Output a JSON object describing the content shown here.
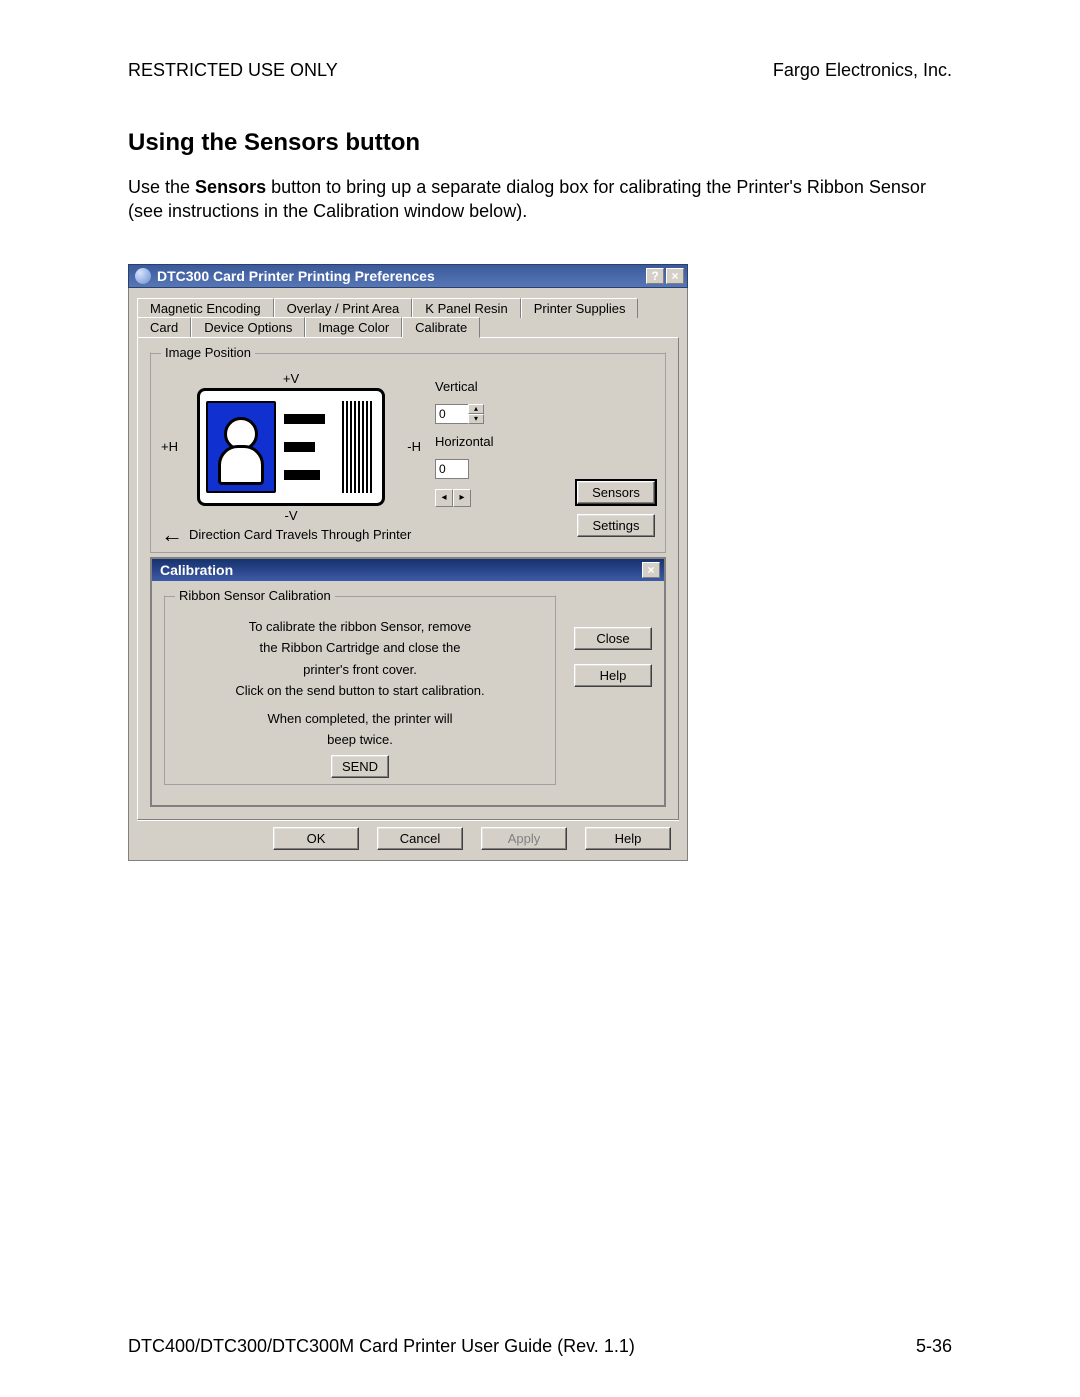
{
  "header": {
    "left": "RESTRICTED USE ONLY",
    "right": "Fargo Electronics, Inc."
  },
  "section_title": "Using the Sensors button",
  "body_pre": "Use the ",
  "body_bold": "Sensors",
  "body_post": " button to bring up a separate dialog box for calibrating the Printer's Ribbon Sensor (see instructions in the Calibration window below).",
  "footer": {
    "left": "DTC400/DTC300/DTC300M Card Printer User Guide (Rev. 1.1)",
    "right": "5-36"
  },
  "dialog": {
    "title": "DTC300 Card Printer Printing Preferences",
    "help_btn": "?",
    "close_btn": "×",
    "tabs_top": [
      "Magnetic Encoding",
      "Overlay / Print Area",
      "K Panel Resin",
      "Printer Supplies"
    ],
    "tabs_bottom": [
      "Card",
      "Device Options",
      "Image Color",
      "Calibrate"
    ],
    "active_tab": "Calibrate",
    "imgpos": {
      "legend": "Image Position",
      "plusV": "+V",
      "minusV": "-V",
      "plusH": "+H",
      "minusH": "-H",
      "direction": "Direction Card Travels Through Printer",
      "vertical_label": "Vertical",
      "horizontal_label": "Horizontal",
      "vertical_value": "0",
      "horizontal_value": "0"
    },
    "buttons": {
      "sensors": "Sensors",
      "settings": "Settings"
    },
    "footer": {
      "ok": "OK",
      "cancel": "Cancel",
      "apply": "Apply",
      "help": "Help"
    }
  },
  "calibration": {
    "title": "Calibration",
    "close_btn": "×",
    "group_legend": "Ribbon Sensor Calibration",
    "line1": "To calibrate the ribbon Sensor, remove",
    "line2": "the Ribbon Cartridge and close the",
    "line3": "printer's front cover.",
    "line4": "Click on the send button to start calibration.",
    "line5": "When completed, the printer will",
    "line6": "beep twice.",
    "send": "SEND",
    "close": "Close",
    "help": "Help"
  }
}
